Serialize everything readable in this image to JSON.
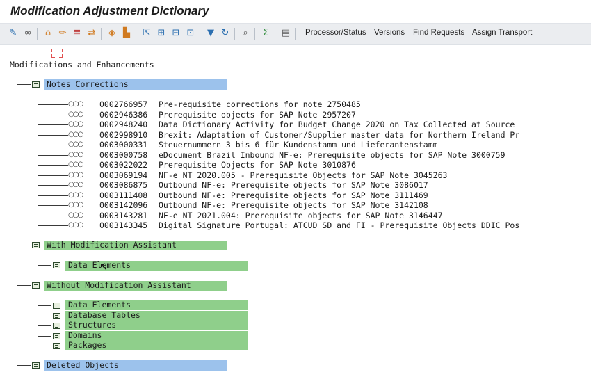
{
  "window": {
    "title": "Modification Adjustment Dictionary"
  },
  "toolbar": {
    "icons": [
      "pencil-icon",
      "glasses-icon",
      "hierarchy-icon",
      "pencil-icon",
      "list-icon",
      "transfer-icon",
      "adjust-icon",
      "import-icon",
      "select-icon",
      "expand-icon",
      "collapse-icon",
      "subtree-icon",
      "filter-icon",
      "refresh-icon",
      "search-icon",
      "execute-icon",
      "legend-icon"
    ],
    "buttons": {
      "processor_status": "Processor/Status",
      "versions": "Versions",
      "find_requests": "Find Requests",
      "assign_transport": "Assign Transport"
    }
  },
  "tree": {
    "root": "Modifications and Enhancements",
    "notes_corrections": {
      "label": "Notes Corrections",
      "items": [
        {
          "num": "0002766957",
          "text": "Pre-requisite corrections for note 2750485"
        },
        {
          "num": "0002946386",
          "text": "Prerequisite objects for SAP Note 2957207"
        },
        {
          "num": "0002948240",
          "text": "Data Dictionary Activity for Budget Change 2020 on Tax Collected at Source"
        },
        {
          "num": "0002998910",
          "text": "Brexit: Adaptation of Customer/Supplier master data for Northern Ireland Pr"
        },
        {
          "num": "0003000331",
          "text": "Steuernummern 3 bis 6 für Kundenstamm und Lieferantenstamm"
        },
        {
          "num": "0003000758",
          "text": "eDocument Brazil Inbound NF-e: Prerequisite objects for SAP Note 3000759"
        },
        {
          "num": "0003022022",
          "text": "Prerequisite Objects for SAP Note 3010876"
        },
        {
          "num": "0003069194",
          "text": "NF-e NT 2020.005 - Prerequisite Objects for SAP Note 3045263"
        },
        {
          "num": "0003086875",
          "text": "Outbound NF-e: Prerequisite objects for SAP Note 3086017"
        },
        {
          "num": "0003111408",
          "text": "Outbound NF-e: Prerequisite objects for SAP Note 3111469"
        },
        {
          "num": "0003142096",
          "text": "Outbound NF-e: Prerequisite objects for SAP Note 3142108"
        },
        {
          "num": "0003143281",
          "text": "NF-e NT 2021.004: Prerequisite objects for SAP Note 3146447"
        },
        {
          "num": "0003143345",
          "text": "Digital Signature Portugal: ATCUD SD and FI - Prerequisite Objects DDIC Pos"
        }
      ]
    },
    "with_assistant": {
      "label": "With Modification Assistant",
      "children": [
        "Data Elements"
      ]
    },
    "without_assistant": {
      "label": "Without Modification Assistant",
      "children": [
        "Data Elements",
        "Database Tables",
        "Structures",
        "Domains",
        "Packages"
      ]
    },
    "deleted_objects": {
      "label": "Deleted Objects"
    }
  },
  "colors": {
    "selected_blue": "#9cc2ec",
    "highlight_green": "#8fcf8b"
  }
}
